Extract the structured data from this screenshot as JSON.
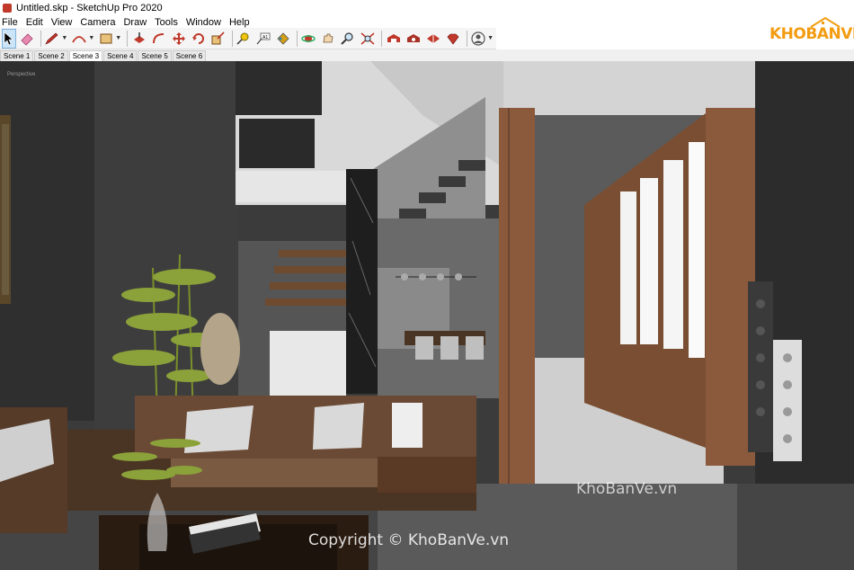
{
  "window": {
    "title": "Untitled.skp - SketchUp Pro 2020"
  },
  "menu": [
    "File",
    "Edit",
    "View",
    "Camera",
    "Draw",
    "Tools",
    "Window",
    "Help"
  ],
  "toolbar": {
    "tools": [
      {
        "name": "select-tool-button",
        "icon": "arrow-cursor-icon"
      },
      {
        "name": "eraser-tool-button",
        "icon": "eraser-icon"
      },
      {
        "name": "line-tool-button",
        "icon": "pencil-icon",
        "dropdown": true
      },
      {
        "name": "arc-tool-button",
        "icon": "arc-icon",
        "dropdown": true
      },
      {
        "name": "shape-tool-button",
        "icon": "rectangle-icon",
        "dropdown": true
      },
      {
        "name": "push-pull-tool-button",
        "icon": "push-pull-icon"
      },
      {
        "name": "follow-me-tool-button",
        "icon": "follow-me-icon"
      },
      {
        "name": "move-tool-button",
        "icon": "move-icon"
      },
      {
        "name": "rotate-tool-button",
        "icon": "rotate-icon"
      },
      {
        "name": "scale-tool-button",
        "icon": "scale-icon"
      },
      {
        "name": "tape-measure-tool-button",
        "icon": "tape-measure-icon"
      },
      {
        "name": "text-tool-button",
        "icon": "text-icon"
      },
      {
        "name": "paint-bucket-tool-button",
        "icon": "paint-bucket-icon"
      },
      {
        "name": "orbit-tool-button",
        "icon": "orbit-icon"
      },
      {
        "name": "pan-tool-button",
        "icon": "pan-hand-icon"
      },
      {
        "name": "zoom-tool-button",
        "icon": "zoom-icon"
      },
      {
        "name": "zoom-extents-button",
        "icon": "zoom-extents-icon"
      },
      {
        "name": "3d-warehouse-button",
        "icon": "warehouse-icon"
      },
      {
        "name": "extension-warehouse-button",
        "icon": "extension-icon"
      },
      {
        "name": "layout-button",
        "icon": "layout-icon"
      },
      {
        "name": "extension-manager-button",
        "icon": "ruby-icon"
      },
      {
        "name": "account-button",
        "icon": "user-icon",
        "dropdown": true
      }
    ]
  },
  "logo": {
    "text": "KHOBANVE"
  },
  "scenes": [
    "Scene 1",
    "Scene 2",
    "Scene 3",
    "Scene 4",
    "Scene 5",
    "Scene 6"
  ],
  "active_scene": "Scene 3",
  "viewport": {
    "view_label": "Perspective",
    "watermark_small": "KhoBanVe.vn",
    "watermark_large": "Copyright © KhoBanVe.vn"
  },
  "colors": {
    "accent": "#f39c12",
    "wood": "#8b5a3c",
    "sofa": "#5a3f2c",
    "wall_dark": "#3a3a3a"
  }
}
